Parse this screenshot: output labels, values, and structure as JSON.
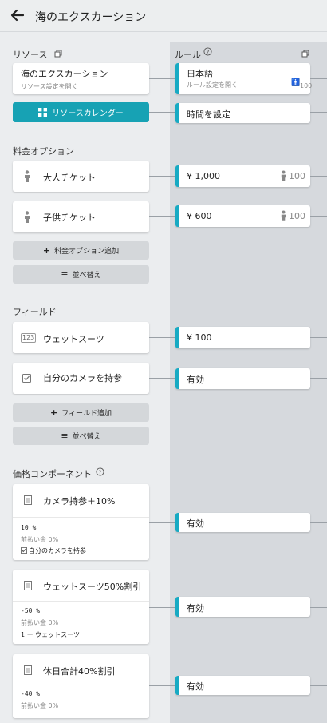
{
  "header": {
    "title": "海のエクスカーション"
  },
  "resources": {
    "label": "リソース",
    "card_title": "海のエクスカーション",
    "card_sub": "リソース設定を開く",
    "calendar_button": "リソースカレンダー"
  },
  "rules": {
    "label": "ルール",
    "language": {
      "title": "日本語",
      "sub": "ルール設定を開く",
      "count": "100"
    },
    "time": "時間を設定"
  },
  "pricing": {
    "label": "料金オプション",
    "items": [
      {
        "label": "大人チケット",
        "price": "¥ 1,000",
        "count": "100"
      },
      {
        "label": "子供チケット",
        "price": "¥ 600",
        "count": "100"
      }
    ],
    "add_button": "料金オプション追加",
    "sort_button": "並べ替え"
  },
  "fields": {
    "label": "フィールド",
    "items": [
      {
        "label": "ウェットスーツ",
        "icon_text": "123",
        "rule": "¥ 100"
      },
      {
        "label": "自分のカメラを持参",
        "rule": "有効"
      }
    ],
    "add_button": "フィールド追加",
    "sort_button": "並べ替え"
  },
  "components": {
    "label": "価格コンポーネント",
    "items": [
      {
        "title": "カメラ持参＋10%",
        "value": "10 %",
        "prepay": "前払い金 0%",
        "cond": "自分のカメラを持参",
        "rule": "有効"
      },
      {
        "title": "ウェットスーツ50%割引",
        "value": "-50 %",
        "prepay": "前払い金 0%",
        "cond": "1 ー ウェットスーツ",
        "rule": "有効"
      },
      {
        "title": "休日合計40%割引",
        "value": "-40 %",
        "prepay": "前払い金 0%",
        "rule": "有効"
      }
    ]
  }
}
